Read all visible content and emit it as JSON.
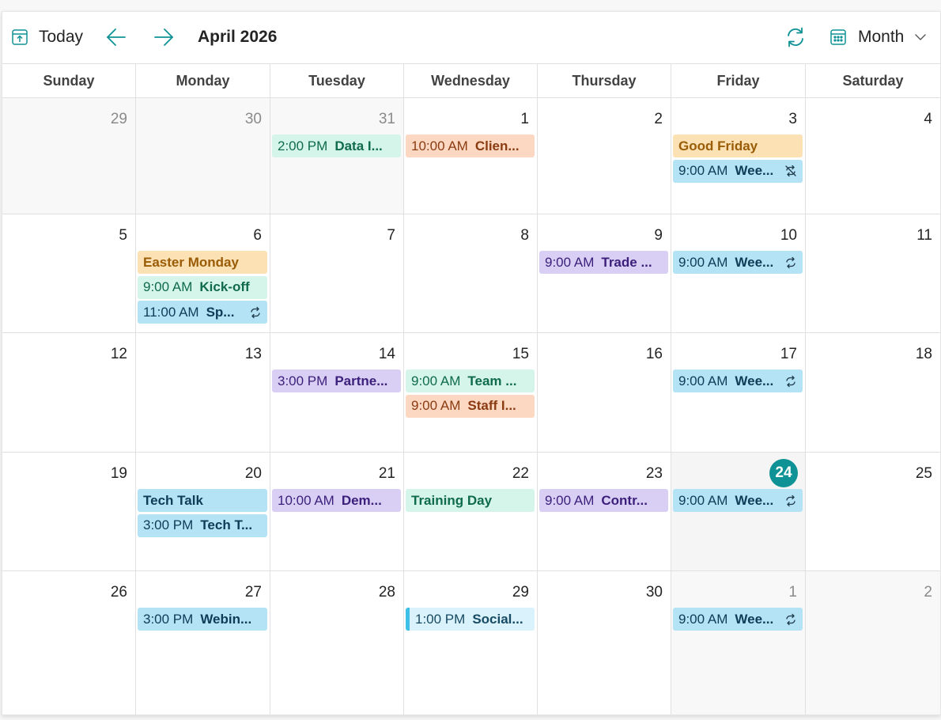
{
  "toolbar": {
    "today_label": "Today",
    "title": "April 2026",
    "view_label": "Month"
  },
  "weekdays": [
    "Sunday",
    "Monday",
    "Tuesday",
    "Wednesday",
    "Thursday",
    "Friday",
    "Saturday"
  ],
  "colors": {
    "accent": "#0f9295",
    "blue": "#b3e3f5",
    "green": "#d5f5ea",
    "orange": "#fcd8c2",
    "gold": "#fbe1b4",
    "purple": "#d9cff5",
    "lightblue": "#d9f2fb"
  },
  "weeks": [
    [
      {
        "day": "29",
        "other": true,
        "events": []
      },
      {
        "day": "30",
        "other": true,
        "events": []
      },
      {
        "day": "31",
        "other": true,
        "events": [
          {
            "time": "2:00 PM",
            "name": "Data I...",
            "color": "green"
          }
        ]
      },
      {
        "day": "1",
        "events": [
          {
            "time": "10:00 AM",
            "name": "Clien...",
            "color": "orange"
          }
        ]
      },
      {
        "day": "2",
        "events": []
      },
      {
        "day": "3",
        "events": [
          {
            "time": "",
            "name": "Good Friday",
            "color": "gold"
          },
          {
            "time": "9:00 AM",
            "name": "Wee...",
            "color": "blue",
            "icon": "recurrence-exception-icon"
          }
        ]
      },
      {
        "day": "4",
        "events": []
      }
    ],
    [
      {
        "day": "5",
        "events": []
      },
      {
        "day": "6",
        "events": [
          {
            "time": "",
            "name": "Easter Monday",
            "color": "gold"
          },
          {
            "time": "9:00 AM",
            "name": "Kick-off",
            "color": "green"
          },
          {
            "time": "11:00 AM",
            "name": "Sp...",
            "color": "blue",
            "icon": "recurring-icon"
          }
        ]
      },
      {
        "day": "7",
        "events": []
      },
      {
        "day": "8",
        "events": []
      },
      {
        "day": "9",
        "events": [
          {
            "time": "9:00 AM",
            "name": "Trade ...",
            "color": "purple"
          }
        ]
      },
      {
        "day": "10",
        "events": [
          {
            "time": "9:00 AM",
            "name": "Wee...",
            "color": "blue",
            "icon": "recurring-icon"
          }
        ]
      },
      {
        "day": "11",
        "events": []
      }
    ],
    [
      {
        "day": "12",
        "events": []
      },
      {
        "day": "13",
        "events": []
      },
      {
        "day": "14",
        "events": [
          {
            "time": "3:00 PM",
            "name": "Partne...",
            "color": "purple"
          }
        ]
      },
      {
        "day": "15",
        "events": [
          {
            "time": "9:00 AM",
            "name": "Team ...",
            "color": "green"
          },
          {
            "time": "9:00 AM",
            "name": "Staff I...",
            "color": "orange"
          }
        ]
      },
      {
        "day": "16",
        "events": []
      },
      {
        "day": "17",
        "events": [
          {
            "time": "9:00 AM",
            "name": "Wee...",
            "color": "blue",
            "icon": "recurring-icon"
          }
        ]
      },
      {
        "day": "18",
        "events": []
      }
    ],
    [
      {
        "day": "19",
        "events": []
      },
      {
        "day": "20",
        "events": [
          {
            "time": "",
            "name": "Tech Talk",
            "color": "blue"
          },
          {
            "time": "3:00 PM",
            "name": "Tech T...",
            "color": "blue"
          }
        ]
      },
      {
        "day": "21",
        "events": [
          {
            "time": "10:00 AM",
            "name": "Dem...",
            "color": "purple"
          }
        ]
      },
      {
        "day": "22",
        "events": [
          {
            "time": "",
            "name": "Training Day",
            "color": "green"
          }
        ]
      },
      {
        "day": "23",
        "events": [
          {
            "time": "9:00 AM",
            "name": "Contr...",
            "color": "purple"
          }
        ]
      },
      {
        "day": "24",
        "today": true,
        "events": [
          {
            "time": "9:00 AM",
            "name": "Wee...",
            "color": "blue",
            "icon": "recurring-icon"
          }
        ]
      },
      {
        "day": "25",
        "events": []
      }
    ],
    [
      {
        "day": "26",
        "events": []
      },
      {
        "day": "27",
        "events": [
          {
            "time": "3:00 PM",
            "name": "Webin...",
            "color": "blue"
          }
        ]
      },
      {
        "day": "28",
        "events": []
      },
      {
        "day": "29",
        "events": [
          {
            "time": "1:00 PM",
            "name": "Social...",
            "color": "lightblue"
          }
        ]
      },
      {
        "day": "30",
        "events": []
      },
      {
        "day": "1",
        "other": true,
        "events": [
          {
            "time": "9:00 AM",
            "name": "Wee...",
            "color": "blue",
            "icon": "recurring-icon"
          }
        ]
      },
      {
        "day": "2",
        "other": true,
        "events": []
      }
    ]
  ]
}
